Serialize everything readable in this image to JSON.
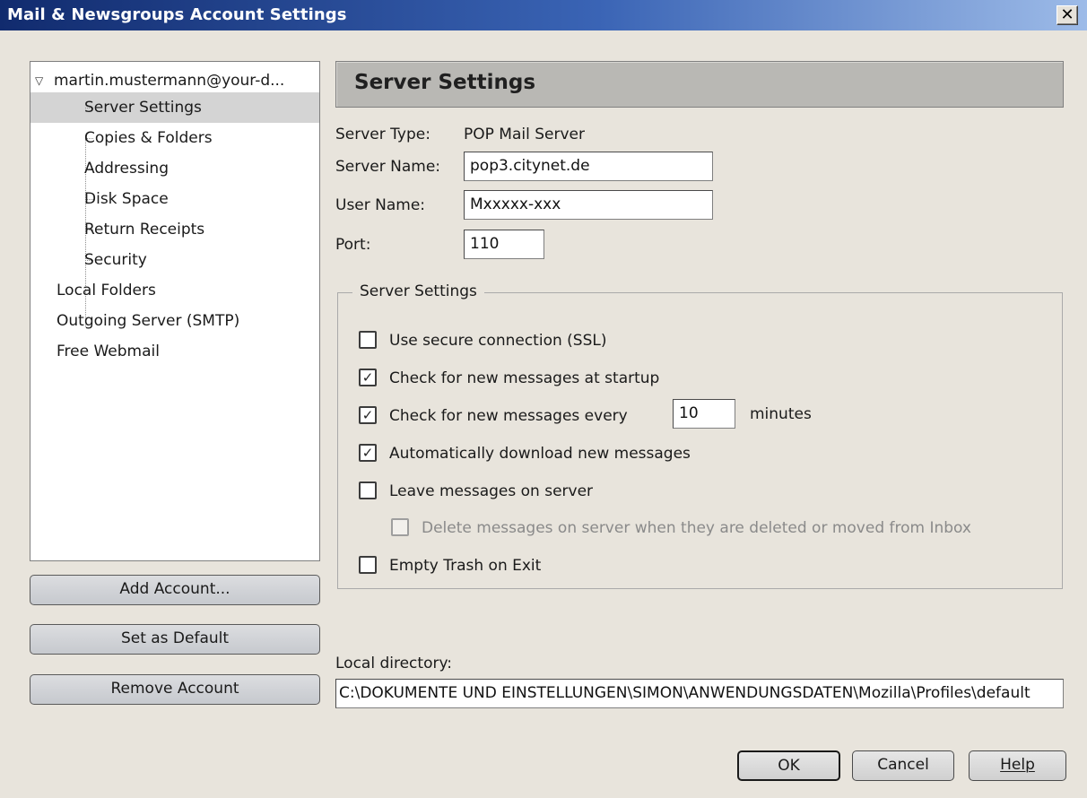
{
  "window": {
    "title": "Mail & Newsgroups Account Settings",
    "close_glyph": "✕"
  },
  "tree": {
    "account": "martin.mustermann@your-d...",
    "children": [
      "Server Settings",
      "Copies & Folders",
      "Addressing",
      "Disk Space",
      "Return Receipts",
      "Security"
    ],
    "others": [
      "Local Folders",
      "Outgoing Server (SMTP)",
      "Free Webmail"
    ],
    "selected": "Server Settings"
  },
  "side_buttons": {
    "add": "Add Account...",
    "default": "Set as Default",
    "remove": "Remove Account"
  },
  "panel": {
    "title": "Server Settings",
    "server_type_label": "Server Type:",
    "server_type_value": "POP Mail Server",
    "server_name_label": "Server Name:",
    "server_name_value": "pop3.citynet.de",
    "user_name_label": "User Name:",
    "user_name_value": "Mxxxxx-xxx",
    "port_label": "Port:",
    "port_value": "110"
  },
  "group": {
    "legend": "Server Settings",
    "ssl": {
      "label": "Use secure connection (SSL)",
      "checked": false
    },
    "check_startup": {
      "label": "Check for new messages at startup",
      "checked": true
    },
    "check_every": {
      "label": "Check for new messages every",
      "checked": true,
      "minutes_value": "10",
      "minutes_unit": "minutes"
    },
    "auto_download": {
      "label": "Automatically download new messages",
      "checked": true
    },
    "leave_on_server": {
      "label": "Leave messages on server",
      "checked": false
    },
    "delete_on_server": {
      "label": "Delete messages on server when they are deleted or moved from Inbox",
      "checked": false,
      "disabled": true
    },
    "empty_trash": {
      "label": "Empty Trash on Exit",
      "checked": false
    }
  },
  "local_directory": {
    "label": "Local directory:",
    "value": "C:\\DOKUMENTE UND EINSTELLUNGEN\\SIMON\\ANWENDUNGSDATEN\\Mozilla\\Profiles\\default"
  },
  "dialog_buttons": {
    "ok": "OK",
    "cancel": "Cancel",
    "help": "Help"
  },
  "icons": {
    "checkmark": "✓",
    "twisty": "▽"
  }
}
